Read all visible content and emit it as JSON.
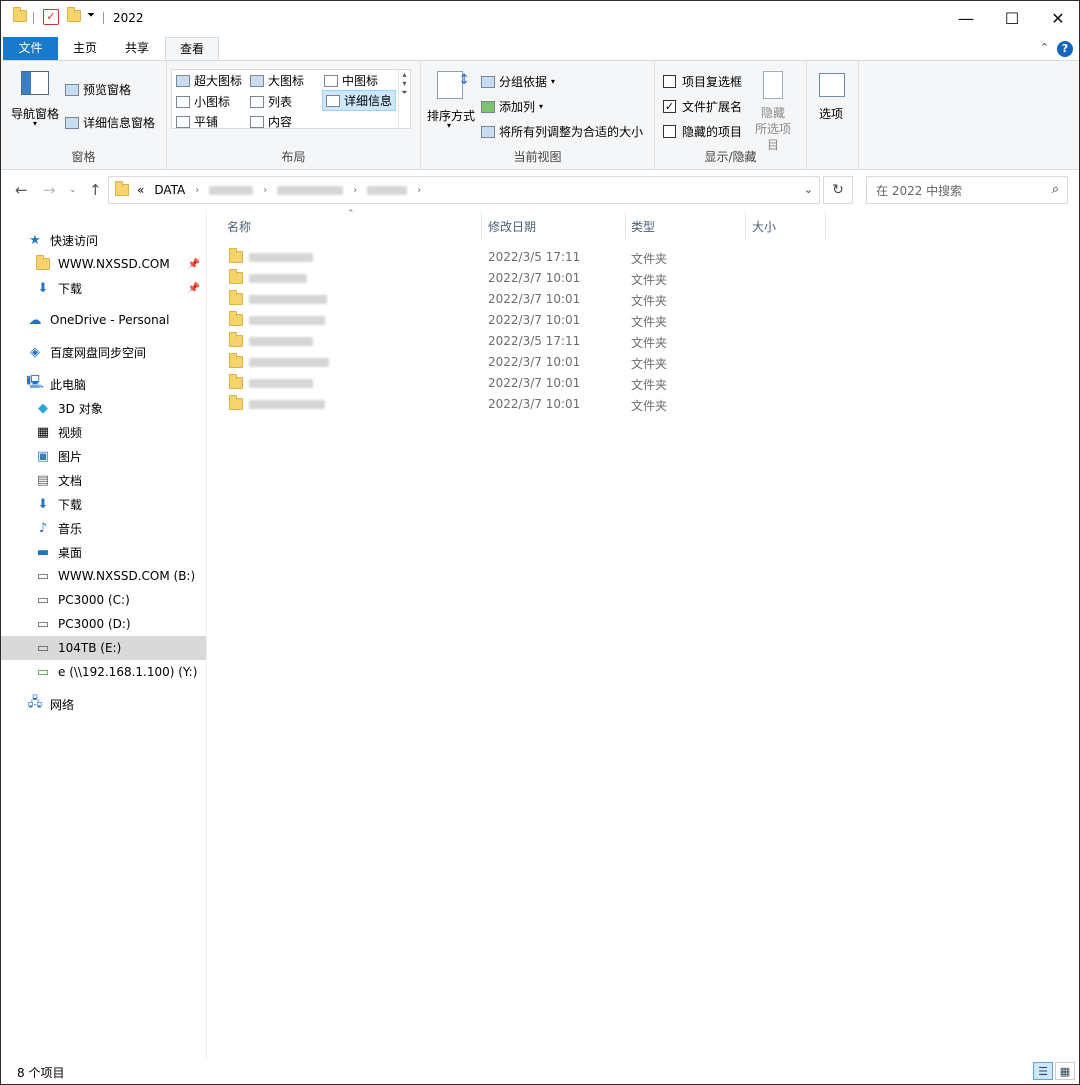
{
  "window": {
    "title": "2022"
  },
  "ribbon_tabs": {
    "file": "文件",
    "home": "主页",
    "share": "共享",
    "view": "查看"
  },
  "ribbon": {
    "panes": {
      "nav_pane": "导航窗格",
      "preview_pane": "预览窗格",
      "details_pane": "详细信息窗格",
      "group_label": "窗格"
    },
    "layout": {
      "extra_large": "超大图标",
      "large": "大图标",
      "medium": "中图标",
      "small": "小图标",
      "list": "列表",
      "details": "详细信息",
      "tiles": "平铺",
      "content": "内容",
      "group_label": "布局"
    },
    "current_view": {
      "sort_by": "排序方式",
      "group_by": "分组依据",
      "add_columns": "添加列",
      "size_all_columns": "将所有列调整为合适的大小",
      "group_label": "当前视图"
    },
    "show_hide": {
      "item_checkboxes": "项目复选框",
      "item_checkboxes_checked": false,
      "file_extensions": "文件扩展名",
      "file_extensions_checked": true,
      "hidden_items": "隐藏的项目",
      "hidden_items_checked": false,
      "hide_selected_1": "隐藏",
      "hide_selected_2": "所选项目",
      "group_label": "显示/隐藏"
    },
    "options": "选项"
  },
  "address": {
    "prefix": "«",
    "root": "DATA",
    "check_mark": "✓",
    "refresh": "↻"
  },
  "search": {
    "placeholder": "在 2022 中搜索"
  },
  "nav": {
    "quick_access": "快速访问",
    "pinned_1": "WWW.NXSSD.COM",
    "pinned_2": "下载",
    "onedrive": "OneDrive - Personal",
    "baidu": "百度网盘同步空间",
    "this_pc": "此电脑",
    "objects3d": "3D 对象",
    "videos": "视频",
    "pictures": "图片",
    "documents": "文档",
    "downloads": "下载",
    "music": "音乐",
    "desktop": "桌面",
    "drive_b": "WWW.NXSSD.COM (B:)",
    "drive_c": "PC3000 (C:)",
    "drive_d": "PC3000 (D:)",
    "drive_e": "104TB (E:)",
    "drive_y": "e (\\\\192.168.1.100) (Y:)",
    "network": "网络"
  },
  "columns": {
    "name": "名称",
    "modified": "修改日期",
    "type": "类型",
    "size": "大小"
  },
  "files": [
    {
      "date": "2022/3/5 17:11",
      "type": "文件夹"
    },
    {
      "date": "2022/3/7 10:01",
      "type": "文件夹"
    },
    {
      "date": "2022/3/7 10:01",
      "type": "文件夹"
    },
    {
      "date": "2022/3/7 10:01",
      "type": "文件夹"
    },
    {
      "date": "2022/3/5 17:11",
      "type": "文件夹"
    },
    {
      "date": "2022/3/7 10:01",
      "type": "文件夹"
    },
    {
      "date": "2022/3/7 10:01",
      "type": "文件夹"
    },
    {
      "date": "2022/3/7 10:01",
      "type": "文件夹"
    }
  ],
  "status": {
    "count": "8 个项目"
  }
}
